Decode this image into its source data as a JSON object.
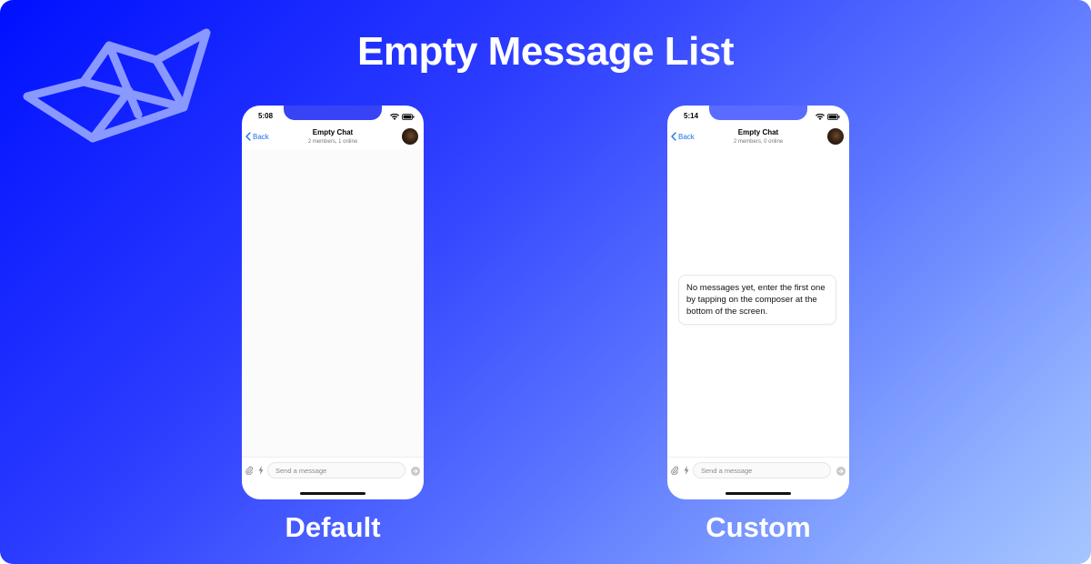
{
  "banner": {
    "title": "Empty Message List",
    "captions": {
      "default": "Default",
      "custom": "Custom"
    },
    "colors": {
      "gradient_start": "#0010ff",
      "gradient_end": "#a6c6ff",
      "logo": "#8a99ff"
    }
  },
  "phones": {
    "default": {
      "time": "5:08",
      "back_label": "Back",
      "chat_title": "Empty Chat",
      "chat_subtitle": "2 members, 1 online",
      "composer_placeholder": "Send a message"
    },
    "custom": {
      "time": "5:14",
      "back_label": "Back",
      "chat_title": "Empty Chat",
      "chat_subtitle": "2 members, 0 online",
      "empty_message": "No messages yet, enter the first one by tapping on the composer at the bottom of the screen.",
      "composer_placeholder": "Send a message"
    }
  },
  "icons": [
    "logo-boat-icon",
    "wifi-icon",
    "battery-icon",
    "back-chevron-icon",
    "attachment-icon",
    "commands-bolt-icon",
    "send-icon"
  ]
}
